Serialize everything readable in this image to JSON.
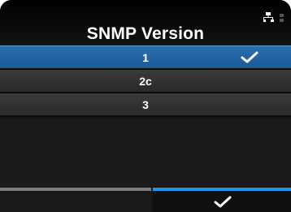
{
  "screen": {
    "title": "SNMP Version"
  },
  "status": {
    "icon": "network-icon"
  },
  "options": [
    {
      "label": "1",
      "selected": true
    },
    {
      "label": "2c",
      "selected": false
    },
    {
      "label": "3",
      "selected": false
    }
  ],
  "softkeys": {
    "left_icon": "",
    "right_icon": "checkmark-icon"
  },
  "colors": {
    "background": "#151515",
    "selection": "#1d5994",
    "softkey_active": "#1f97e4",
    "softkey_inactive": "#7d7d7d"
  }
}
